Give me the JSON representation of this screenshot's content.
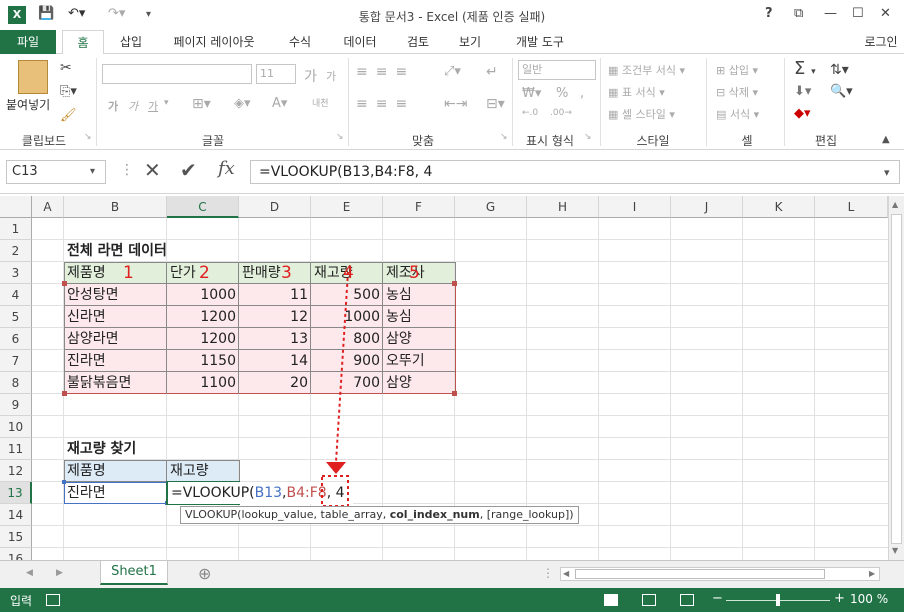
{
  "window": {
    "title": "통합 문서3 - Excel (제품 인증 실패)",
    "help": "?",
    "controls": {
      "restore_ribbon": "⧉",
      "minimize": "—",
      "maximize": "☐",
      "close": "✕"
    }
  },
  "ribbon_tabs": [
    "파일",
    "홈",
    "삽입",
    "페이지 레이아웃",
    "수식",
    "데이터",
    "검토",
    "보기",
    "개발 도구"
  ],
  "login": "로그인",
  "ribbon": {
    "clipboard": {
      "paste": "붙여넣기",
      "label": "클립보드"
    },
    "font": {
      "size": "11",
      "label": "글꼴",
      "grow": "가",
      "shrink": "가",
      "bold": "가",
      "italic": "가",
      "underline": "가",
      "phonetic": "내천"
    },
    "alignment": {
      "label": "맞춤"
    },
    "number": {
      "format": "일반",
      "label": "표시 형식",
      "percent": "%"
    },
    "styles": {
      "conditional": "조건부 서식",
      "table": "표 서식",
      "cell_style": "셀 스타일",
      "label": "스타일"
    },
    "cells": {
      "insert": "삽입",
      "delete": "삭제",
      "format": "서식",
      "label": "셀"
    },
    "editing": {
      "label": "편집"
    }
  },
  "namebox": "C13",
  "formula": "=VLOOKUP(B13,B4:F8, 4",
  "columns": [
    "A",
    "B",
    "C",
    "D",
    "E",
    "F",
    "G",
    "H",
    "I",
    "J",
    "K",
    "L"
  ],
  "rows": [
    "1",
    "2",
    "3",
    "4",
    "5",
    "6",
    "7",
    "8",
    "9",
    "10",
    "11",
    "12",
    "13",
    "14",
    "15",
    "16"
  ],
  "sheet": {
    "title1": "전체 라면 데이터",
    "headers": [
      "제품명",
      "단가",
      "판매량",
      "재고량",
      "제조사"
    ],
    "col_numbers": [
      "1",
      "2",
      "3",
      "4",
      "5"
    ],
    "data": [
      [
        "안성탕면",
        "1000",
        "11",
        "500",
        "농심"
      ],
      [
        "신라면",
        "1200",
        "12",
        "1000",
        "농심"
      ],
      [
        "삼양라면",
        "1200",
        "13",
        "800",
        "삼양"
      ],
      [
        "진라면",
        "1150",
        "14",
        "900",
        "오뚜기"
      ],
      [
        "불닭볶음면",
        "1100",
        "20",
        "700",
        "삼양"
      ]
    ],
    "title2": "재고량 찾기",
    "lookup_headers": [
      "제품명",
      "재고량"
    ],
    "lookup_name": "진라면",
    "edit": {
      "prefix": "=VLOOKUP(",
      "ref1": "B13",
      "comma1": ",",
      "ref2": "B4:F8",
      "comma2": ",",
      "arg": " 4"
    },
    "tooltip": {
      "start": "VLOOKUP(lookup_value, table_array, ",
      "bold": "col_index_num",
      "end": ", [range_lookup])"
    }
  },
  "sheet_tab": "Sheet1",
  "add_sheet": "⊕",
  "status": {
    "mode": "입력",
    "zoom": "100 %"
  },
  "colors": {
    "excel_green": "#217346",
    "table_fill": "#fde9ec",
    "header_fill": "#e2efda",
    "lookup_header_fill": "#ddebf7",
    "ref1": "#4472c4",
    "ref2": "#c0504d",
    "annotation": "#e02020"
  }
}
